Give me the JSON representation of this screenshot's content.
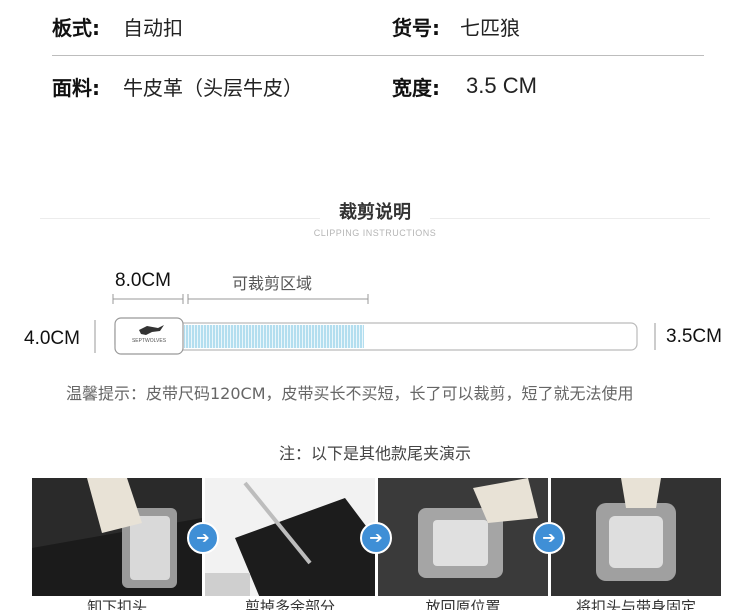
{
  "specs": {
    "style_label": "板式:",
    "style_value": "自动扣",
    "item_label": "货号:",
    "item_value": "七匹狼",
    "material_label": "面料:",
    "material_value": "牛皮革（头层牛皮）",
    "width_label": "宽度:",
    "width_value": "3.5 CM"
  },
  "clipping": {
    "title": "裁剪说明",
    "subtitle": "CLIPPING INSTRUCTIONS",
    "buckle_length": "8.0CM",
    "cut_area_label": "可裁剪区域",
    "left_height": "4.0CM",
    "right_width": "3.5CM",
    "brand_mark": "SEPTWOLVES",
    "tip": "温馨提示：皮带尺码120CM，皮带买长不买短，长了可以裁剪，短了就无法使用"
  },
  "demo": {
    "note": "注：以下是其他款尾夹演示",
    "steps": [
      {
        "caption": "卸下扣头"
      },
      {
        "caption": "剪掉多余部分"
      },
      {
        "caption": "放回原位置"
      },
      {
        "caption": "将扣头与带身固定"
      }
    ],
    "arrow_icon": "arrow-right-icon",
    "accent_color": "#3f8fd6"
  }
}
